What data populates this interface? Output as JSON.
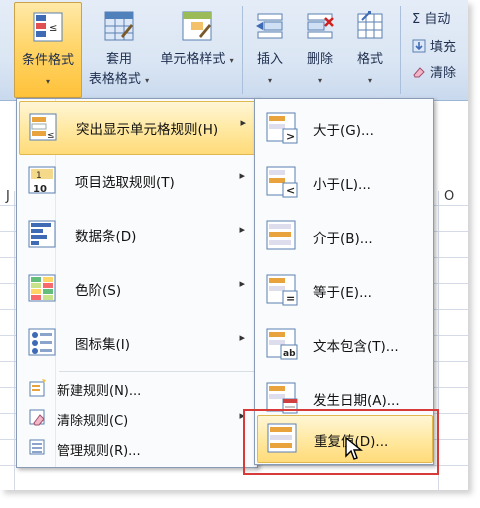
{
  "ribbon": {
    "conditional_format": {
      "label": "条件格式",
      "arrow": "▾"
    },
    "table_format": {
      "line1": "套用",
      "line2": "表格格式",
      "arrow": "▾"
    },
    "cell_style": {
      "label": "单元格样式",
      "arrow": "▾"
    },
    "insert": {
      "label": "插入",
      "arrow": "▾"
    },
    "delete": {
      "label": "删除",
      "arrow": "▾"
    },
    "format": {
      "label": "格式",
      "arrow": "▾"
    },
    "autosum": {
      "label": "Σ 自动"
    },
    "fill": {
      "label": "填充"
    },
    "clear": {
      "label": "清除"
    }
  },
  "sheet": {
    "col_j": "J",
    "col_o": "O"
  },
  "menu": {
    "items": [
      {
        "label": "突出显示单元格规则(H)",
        "arrow": "▸"
      },
      {
        "label": "项目选取规则(T)",
        "arrow": "▸"
      },
      {
        "label": "数据条(D)",
        "arrow": "▸"
      },
      {
        "label": "色阶(S)",
        "arrow": "▸"
      },
      {
        "label": "图标集(I)",
        "arrow": "▸"
      }
    ],
    "small_items": [
      {
        "label": "新建规则(N)..."
      },
      {
        "label": "清除规则(C)",
        "arrow": "▸"
      },
      {
        "label": "管理规则(R)..."
      }
    ]
  },
  "submenu": {
    "items": [
      {
        "label": "大于(G)..."
      },
      {
        "label": "小于(L)..."
      },
      {
        "label": "介于(B)..."
      },
      {
        "label": "等于(E)..."
      },
      {
        "label": "文本包含(T)..."
      },
      {
        "label": "发生日期(A)..."
      },
      {
        "label": "重复值(D)..."
      }
    ]
  },
  "colors": {
    "highlight": "#ffe9a3",
    "annotation": "#d83a3a",
    "ribbon": "#dbe6f4"
  }
}
